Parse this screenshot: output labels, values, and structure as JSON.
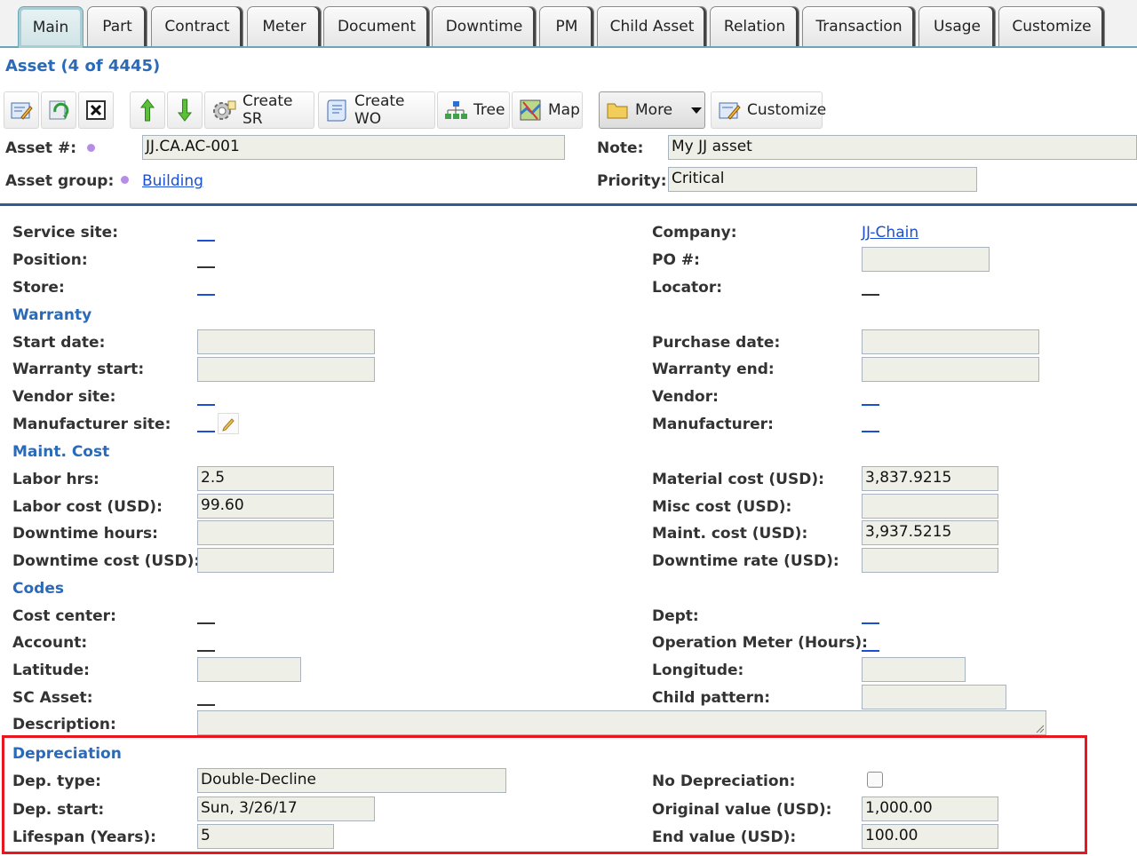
{
  "tabs": [
    "Main",
    "Part",
    "Contract",
    "Meter",
    "Document",
    "Downtime",
    "PM",
    "Child Asset",
    "Relation",
    "Transaction",
    "Usage",
    "Customize"
  ],
  "title": "Asset (4 of 4445)",
  "toolbar": {
    "create_sr": "Create SR",
    "create_wo": "Create WO",
    "tree": "Tree",
    "map": "Map",
    "more": "More",
    "customize": "Customize"
  },
  "header": {
    "asset_num_label": "Asset #:",
    "asset_num_value": "JJ.CA.AC-001",
    "asset_group_label": "Asset group:",
    "asset_group_value": "Building",
    "note_label": "Note:",
    "note_value": "My JJ asset",
    "priority_label": "Priority:",
    "priority_value": "Critical"
  },
  "labels": {
    "service_site": "Service site:",
    "position": "Position:",
    "store": "Store:",
    "start_date": "Start date:",
    "warranty_start": "Warranty start:",
    "vendor_site": "Vendor site:",
    "manufacturer_site": "Manufacturer site:",
    "labor_hrs": "Labor hrs:",
    "labor_cost": "Labor cost (USD):",
    "downtime_hours": "Downtime hours:",
    "downtime_cost": "Downtime cost (USD):",
    "cost_center": "Cost center:",
    "account": "Account:",
    "latitude": "Latitude:",
    "sc_asset": "SC Asset:",
    "description": "Description:",
    "company": "Company:",
    "po_num": "PO #:",
    "locator": "Locator:",
    "purchase_date": "Purchase date:",
    "warranty_end": "Warranty end:",
    "vendor": "Vendor:",
    "manufacturer": "Manufacturer:",
    "material_cost": "Material cost (USD):",
    "misc_cost": "Misc cost (USD):",
    "maint_cost": "Maint. cost (USD):",
    "downtime_rate": "Downtime rate (USD):",
    "dept": "Dept:",
    "operation_meter": "Operation Meter (Hours):",
    "longitude": "Longitude:",
    "child_pattern": "Child pattern:",
    "dep_type": "Dep. type:",
    "dep_start": "Dep. start:",
    "lifespan": "Lifespan (Years):",
    "no_depreciation": "No Depreciation:",
    "original_value": "Original value (USD):",
    "end_value": "End value (USD):"
  },
  "sections": {
    "warranty": "Warranty",
    "maint_cost": "Maint. Cost",
    "codes": "Codes",
    "depreciation": "Depreciation"
  },
  "values": {
    "company": "JJ-Chain",
    "labor_hrs": "2.5",
    "labor_cost": "99.60",
    "material_cost": "3,837.9215",
    "maint_cost": "3,937.5215",
    "dep_type": "Double-Decline",
    "dep_start": "Sun, 3/26/17",
    "lifespan": "5",
    "original_value": "1,000.00",
    "end_value": "100.00",
    "no_depreciation": false
  }
}
